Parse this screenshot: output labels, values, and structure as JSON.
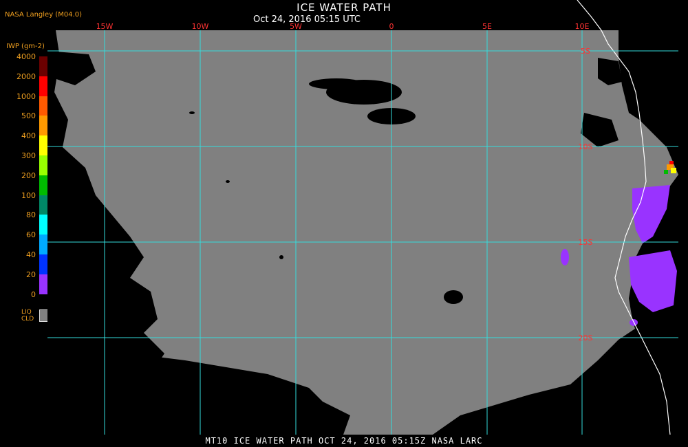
{
  "title": "ICE WATER PATH",
  "subtitle": "Oct 24, 2016 05:15 UTC",
  "source": "NASA Langley (M04.0)",
  "footer": "MT10  ICE WATER PATH   OCT 24, 2016 05:15Z   NASA LARC",
  "legend": {
    "unit": "IWP (gm-2)",
    "ticks": [
      "4000",
      "2000",
      "1000",
      "500",
      "400",
      "300",
      "200",
      "100",
      "80",
      "60",
      "40",
      "20",
      "0"
    ],
    "colors": [
      "#6b0000",
      "#ff0000",
      "#ff5a00",
      "#ff9a00",
      "#ffff00",
      "#99ff00",
      "#00bb00",
      "#008866",
      "#00ffff",
      "#00aaff",
      "#0033ff",
      "#9933ff"
    ],
    "liq_label_1": "LIQ",
    "liq_label_2": "CLD",
    "liq_color": "#808080"
  },
  "grid": {
    "lon_labels": [
      "15W",
      "10W",
      "5W",
      "0",
      "5E",
      "10E"
    ],
    "lat_labels": [
      "5S",
      "10S",
      "15S",
      "20S"
    ],
    "color": "#33dddd"
  },
  "map_colors": {
    "cloud": "#808080",
    "clear": "#000000",
    "ice": "#9933ff",
    "coast": "#ffffff"
  }
}
